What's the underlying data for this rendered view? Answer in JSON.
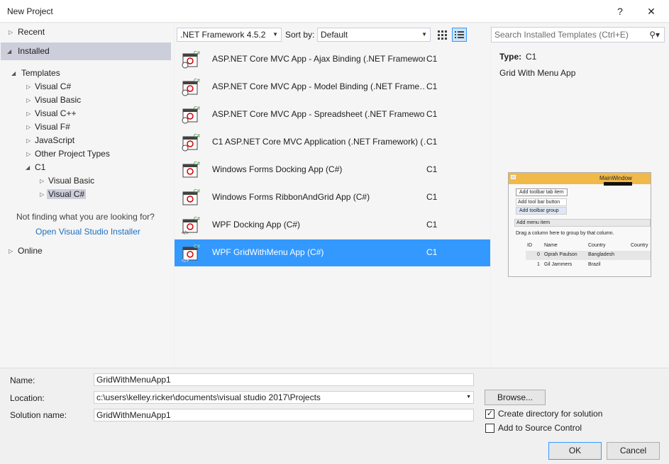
{
  "window": {
    "title": "New Project",
    "help": "?",
    "close": "✕"
  },
  "tree": {
    "recent": "Recent",
    "installed": "Installed",
    "templates": "Templates",
    "items": [
      "Visual C#",
      "Visual Basic",
      "Visual C++",
      "Visual F#",
      "JavaScript",
      "Other Project Types",
      "C1"
    ],
    "c1_children": [
      "Visual Basic",
      "Visual C#"
    ],
    "hint": "Not finding what you are looking for?",
    "installer_link": "Open Visual Studio Installer",
    "online": "Online"
  },
  "toolbar": {
    "framework": ".NET Framework 4.5.2",
    "sort_label": "Sort by:",
    "sort_value": "Default"
  },
  "search": {
    "placeholder": "Search Installed Templates (Ctrl+E)"
  },
  "templates": [
    {
      "name": "ASP.NET Core MVC App - Ajax Binding (.NET Framewor…",
      "lang": "C1"
    },
    {
      "name": "ASP.NET Core MVC App - Model Binding (.NET Frame…",
      "lang": "C1"
    },
    {
      "name": "ASP.NET Core MVC App - Spreadsheet (.NET Framewor…",
      "lang": "C1"
    },
    {
      "name": "C1 ASP.NET Core MVC Application (.NET Framework) (…",
      "lang": "C1"
    },
    {
      "name": "Windows Forms Docking App (C#)",
      "lang": "C1"
    },
    {
      "name": "Windows Forms RibbonAndGrid App (C#)",
      "lang": "C1"
    },
    {
      "name": "WPF Docking App (C#)",
      "lang": "C1"
    },
    {
      "name": "WPF GridWithMenu App (C#)",
      "lang": "C1"
    }
  ],
  "details": {
    "type_label": "Type:",
    "type_value": "C1",
    "description": "Grid With Menu App",
    "preview": {
      "window_title": "MainWindow",
      "tab": "Add toolbar tab item",
      "btn1": "Add tool bar button",
      "btn2": "Add toolbar group",
      "menu": "Add menu item",
      "group_hint": "Drag a column here to group by that column.",
      "headers": [
        "ID",
        "Name",
        "Country",
        "Country"
      ],
      "rows": [
        [
          "0",
          "Oprah Paulson",
          "Bangladesh"
        ],
        [
          "1",
          "Gil Jammers",
          "Brazil"
        ]
      ]
    }
  },
  "form": {
    "name_label": "Name:",
    "name_value": "GridWithMenuApp1",
    "location_label": "Location:",
    "location_value": "c:\\users\\kelley.ricker\\documents\\visual studio 2017\\Projects",
    "solution_label": "Solution name:",
    "solution_value": "GridWithMenuApp1",
    "browse": "Browse...",
    "create_dir": "Create directory for solution",
    "create_dir_checked": "✓",
    "source_control": "Add to Source Control",
    "ok": "OK",
    "cancel": "Cancel"
  }
}
